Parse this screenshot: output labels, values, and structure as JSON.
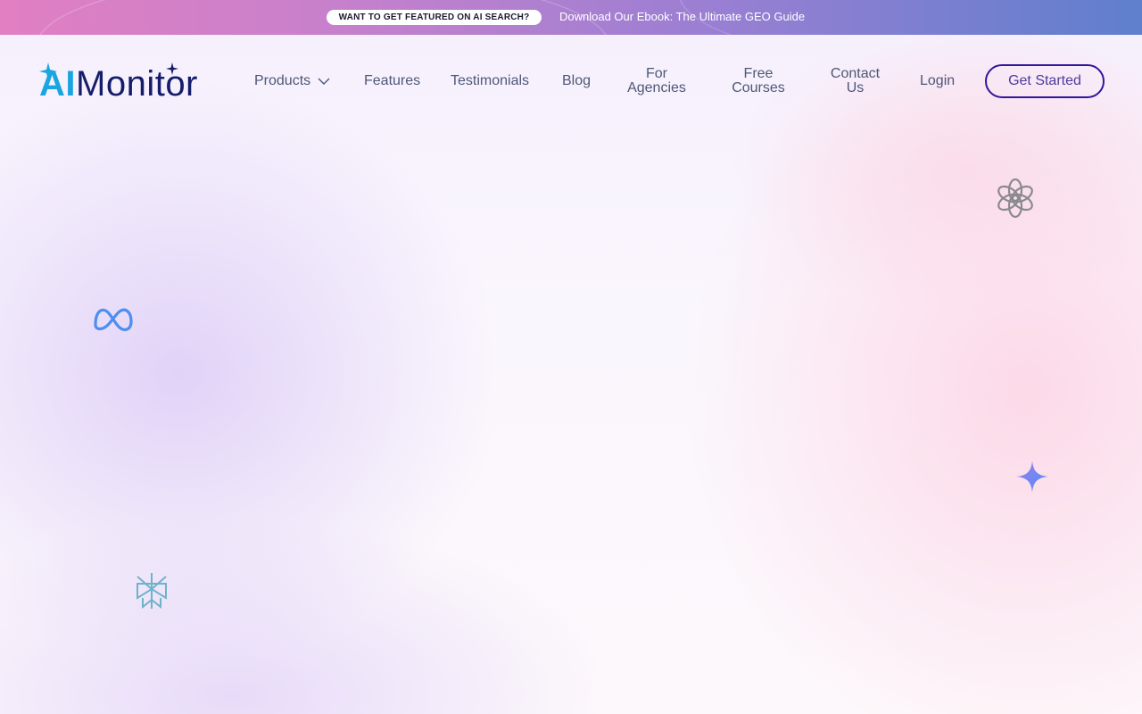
{
  "promo": {
    "pill_text": "WANT TO GET FEATURED ON AI SEARCH?",
    "link_text": "Download Our Ebook: The Ultimate GEO Guide"
  },
  "header": {
    "logo": {
      "ai": "AI",
      "rest": "Monitor"
    },
    "nav": {
      "products": "Products",
      "features": "Features",
      "testimonials": "Testimonials",
      "blog": "Blog",
      "agencies": "For Agencies",
      "courses": "Free Courses",
      "contact": "Contact Us",
      "login": "Login"
    },
    "cta": "Get Started"
  },
  "floating_icons": [
    "openai-icon",
    "meta-icon",
    "gemini-sparkle-icon",
    "perplexity-icon"
  ],
  "colors": {
    "brand_navy": "#151d6b",
    "brand_cyan": "#1ba5e0",
    "cta_border": "#30169b",
    "nav_text": "#4e5777"
  }
}
